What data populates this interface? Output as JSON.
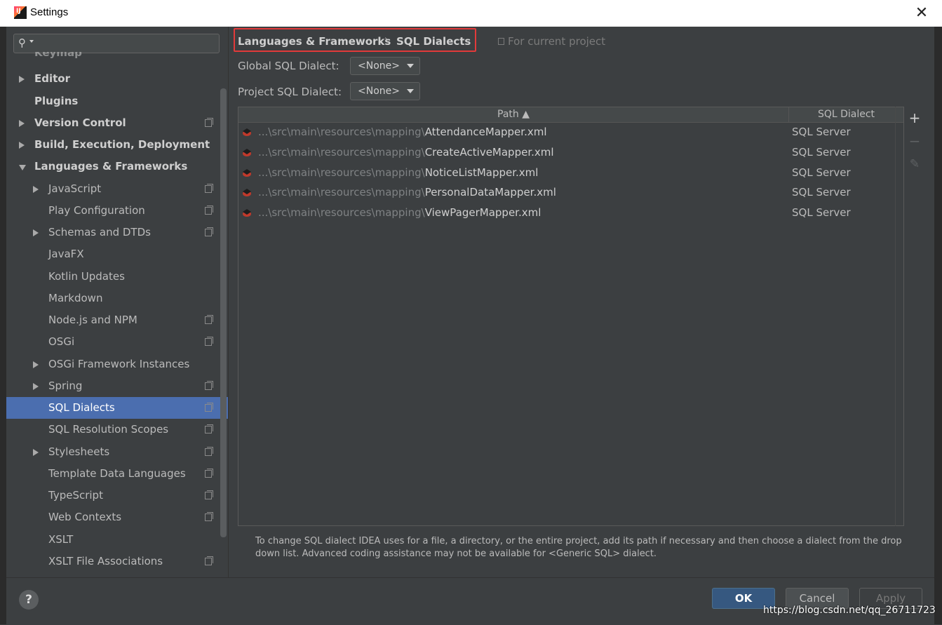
{
  "window": {
    "title": "Settings",
    "close_glyph": "✕"
  },
  "sidebar": {
    "search": {
      "placeholder": ""
    },
    "items": [
      {
        "label": "Keymap",
        "level": 0,
        "expander": "none",
        "bold": true,
        "project": false,
        "selected": false,
        "partial": true
      },
      {
        "label": "Editor",
        "level": 0,
        "expander": "collapsed",
        "bold": true,
        "project": false,
        "selected": false
      },
      {
        "label": "Plugins",
        "level": 0,
        "expander": "none",
        "bold": true,
        "project": false,
        "selected": false
      },
      {
        "label": "Version Control",
        "level": 0,
        "expander": "collapsed",
        "bold": true,
        "project": true,
        "selected": false
      },
      {
        "label": "Build, Execution, Deployment",
        "level": 0,
        "expander": "collapsed",
        "bold": true,
        "project": false,
        "selected": false
      },
      {
        "label": "Languages & Frameworks",
        "level": 0,
        "expander": "expanded",
        "bold": true,
        "project": false,
        "selected": false
      },
      {
        "label": "JavaScript",
        "level": 1,
        "expander": "collapsed",
        "bold": false,
        "project": true,
        "selected": false
      },
      {
        "label": "Play Configuration",
        "level": 1,
        "expander": "none",
        "bold": false,
        "project": true,
        "selected": false
      },
      {
        "label": "Schemas and DTDs",
        "level": 1,
        "expander": "collapsed",
        "bold": false,
        "project": true,
        "selected": false
      },
      {
        "label": "JavaFX",
        "level": 1,
        "expander": "none",
        "bold": false,
        "project": false,
        "selected": false
      },
      {
        "label": "Kotlin Updates",
        "level": 1,
        "expander": "none",
        "bold": false,
        "project": false,
        "selected": false
      },
      {
        "label": "Markdown",
        "level": 1,
        "expander": "none",
        "bold": false,
        "project": false,
        "selected": false
      },
      {
        "label": "Node.js and NPM",
        "level": 1,
        "expander": "none",
        "bold": false,
        "project": true,
        "selected": false
      },
      {
        "label": "OSGi",
        "level": 1,
        "expander": "none",
        "bold": false,
        "project": true,
        "selected": false
      },
      {
        "label": "OSGi Framework Instances",
        "level": 1,
        "expander": "collapsed",
        "bold": false,
        "project": false,
        "selected": false
      },
      {
        "label": "Spring",
        "level": 1,
        "expander": "collapsed",
        "bold": false,
        "project": true,
        "selected": false
      },
      {
        "label": "SQL Dialects",
        "level": 1,
        "expander": "none",
        "bold": false,
        "project": true,
        "selected": true
      },
      {
        "label": "SQL Resolution Scopes",
        "level": 1,
        "expander": "none",
        "bold": false,
        "project": true,
        "selected": false
      },
      {
        "label": "Stylesheets",
        "level": 1,
        "expander": "collapsed",
        "bold": false,
        "project": true,
        "selected": false
      },
      {
        "label": "Template Data Languages",
        "level": 1,
        "expander": "none",
        "bold": false,
        "project": true,
        "selected": false
      },
      {
        "label": "TypeScript",
        "level": 1,
        "expander": "none",
        "bold": false,
        "project": true,
        "selected": false
      },
      {
        "label": "Web Contexts",
        "level": 1,
        "expander": "none",
        "bold": false,
        "project": true,
        "selected": false
      },
      {
        "label": "XSLT",
        "level": 1,
        "expander": "none",
        "bold": false,
        "project": false,
        "selected": false
      },
      {
        "label": "XSLT File Associations",
        "level": 1,
        "expander": "none",
        "bold": false,
        "project": true,
        "selected": false
      }
    ]
  },
  "main": {
    "breadcrumb": {
      "parent": "Languages & Frameworks",
      "separator": "›",
      "current": "SQL Dialects"
    },
    "for_current_project": "For current project",
    "global_dialect": {
      "label": "Global SQL Dialect:",
      "value": "<None>"
    },
    "project_dialect": {
      "label": "Project SQL Dialect:",
      "value": "<None>"
    },
    "table": {
      "columns": {
        "path": "Path ▲",
        "dialect": "SQL Dialect"
      },
      "rows": [
        {
          "prefix": "...\\src\\main\\resources\\mapping\\",
          "file": "AttendanceMapper.xml",
          "dialect": "SQL Server"
        },
        {
          "prefix": "...\\src\\main\\resources\\mapping\\",
          "file": "CreateActiveMapper.xml",
          "dialect": "SQL Server"
        },
        {
          "prefix": "...\\src\\main\\resources\\mapping\\",
          "file": "NoticeListMapper.xml",
          "dialect": "SQL Server"
        },
        {
          "prefix": "...\\src\\main\\resources\\mapping\\",
          "file": "PersonalDataMapper.xml",
          "dialect": "SQL Server"
        },
        {
          "prefix": "...\\src\\main\\resources\\mapping\\",
          "file": "ViewPagerMapper.xml",
          "dialect": "SQL Server"
        }
      ]
    },
    "toolbar": {
      "add_glyph": "+",
      "remove_glyph": "−",
      "edit_glyph": "✎"
    },
    "hint": "To change SQL dialect IDEA uses for a file, a directory, or the entire project, add its path if necessary and then choose a dialect from the drop down list. Advanced coding assistance may not be available for <Generic SQL> dialect."
  },
  "footer": {
    "help_glyph": "?",
    "ok": "OK",
    "cancel": "Cancel",
    "apply": "Apply"
  },
  "watermark": "https://blog.csdn.net/qq_26711723",
  "colors": {
    "bg": "#3c3f41",
    "selection": "#4b6eaf",
    "highlight_box": "#e23a3a",
    "ok_button": "#365880"
  }
}
